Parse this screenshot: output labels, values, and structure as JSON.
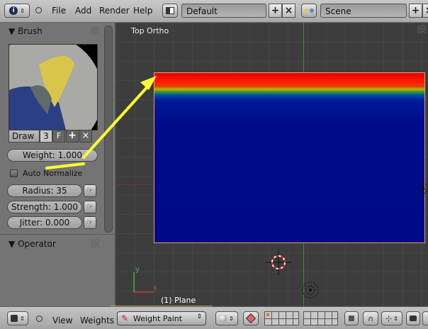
{
  "header": {
    "menus": [
      "File",
      "Add",
      "Render",
      "Help"
    ],
    "layout": "Default",
    "scene": "Scene"
  },
  "brush": {
    "title": "Brush",
    "brush_name": "Draw",
    "users_count": "3",
    "fake_user": "F",
    "weight": "Weight: 1.000",
    "auto_normalize": "Auto Normalize",
    "radius": "Radius: 35",
    "strength": "Strength: 1.000",
    "jitter": "Jitter: 0.000"
  },
  "operator": {
    "title": "Operator"
  },
  "viewport": {
    "view_name": "Top Ortho",
    "object_label": "(1) Plane",
    "axis_y": "y",
    "axis_x": "x"
  },
  "footer": {
    "menus": [
      "View",
      "Weights"
    ],
    "mode": "Weight Paint"
  },
  "colors": {
    "highlight": "#ffff33",
    "weight_low": "#00008b",
    "weight_high": "#ff0000"
  }
}
